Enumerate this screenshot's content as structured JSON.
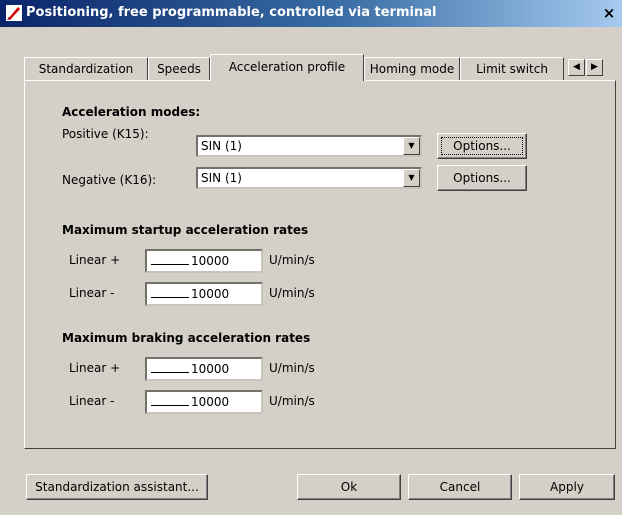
{
  "window": {
    "title": "Positioning, free programmable, controlled via terminal",
    "close_label": "×"
  },
  "tabs": [
    {
      "label": "Standardization"
    },
    {
      "label": "Speeds"
    },
    {
      "label": "Acceleration profile"
    },
    {
      "label": "Homing mode"
    },
    {
      "label": "Limit switch"
    }
  ],
  "tab_scroll": {
    "left": "◀",
    "right": "▶"
  },
  "accel_modes": {
    "heading": "Acceleration modes:",
    "positive_label": "Positive (K15):",
    "positive_value": "SIN (1)",
    "negative_label": "Negative (K16):",
    "negative_value": "SIN (1)",
    "options_label": "Options..."
  },
  "startup": {
    "heading": "Maximum startup acceleration rates",
    "linear_plus_label": "Linear +",
    "linear_plus_value": "10000",
    "linear_minus_label": "Linear -",
    "linear_minus_value": "10000",
    "unit": "U/min/s"
  },
  "braking": {
    "heading": "Maximum braking acceleration rates",
    "linear_plus_label": "Linear +",
    "linear_plus_value": "10000",
    "linear_minus_label": "Linear -",
    "linear_minus_value": "10000",
    "unit": "U/min/s"
  },
  "footer": {
    "assistant_label": "Standardization assistant...",
    "ok_label": "Ok",
    "cancel_label": "Cancel",
    "apply_label": "Apply"
  }
}
